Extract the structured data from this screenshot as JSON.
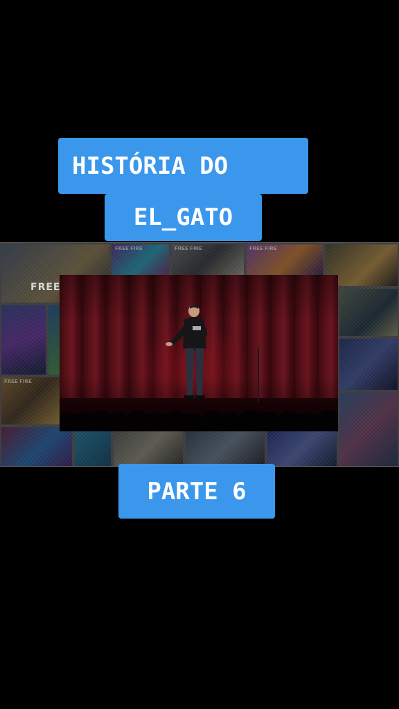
{
  "captions": {
    "line1": "HISTÓRIA DO",
    "line2": "EL_GATO",
    "part": "PARTE 6"
  },
  "collage": {
    "tile_label": "FREE FIRE",
    "big_text": "FREE"
  },
  "colors": {
    "caption_bg": "#3a97ec",
    "caption_text": "#ffffff",
    "background": "#000000",
    "curtain": "#5a1119"
  }
}
